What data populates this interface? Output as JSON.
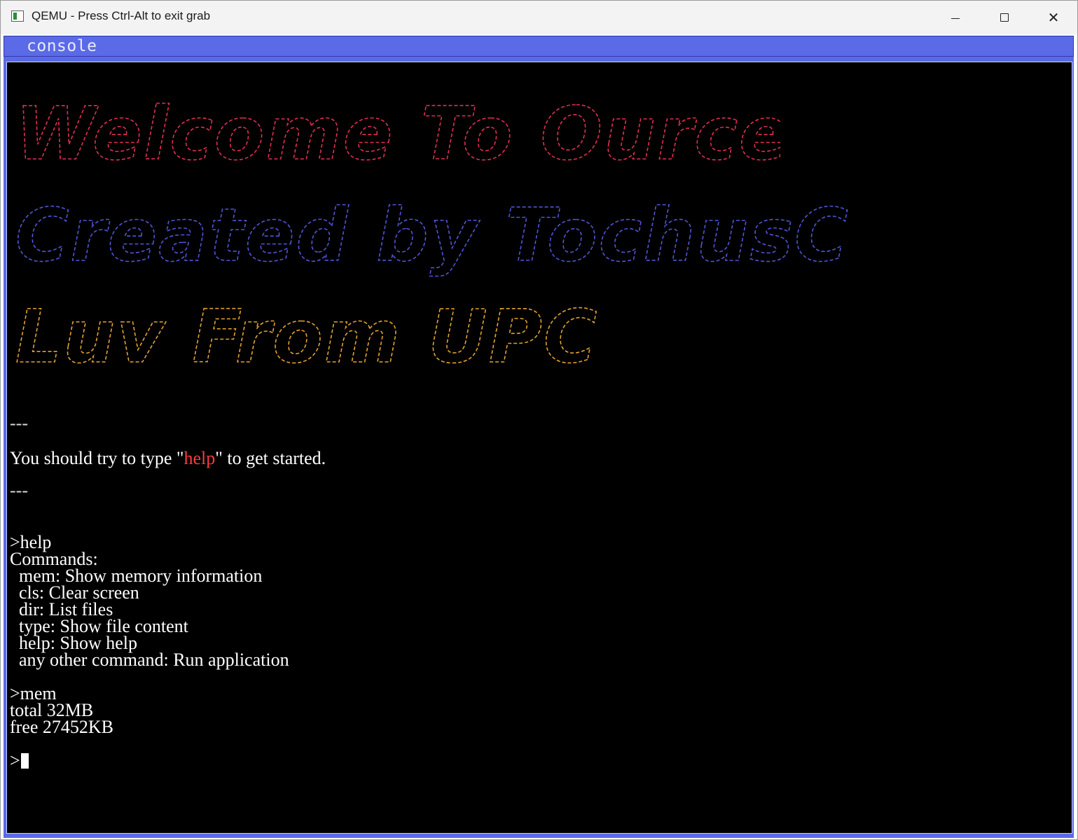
{
  "window": {
    "title": "QEMU - Press Ctrl-Alt to exit grab",
    "controls": {
      "minimize_icon": "minimize-icon",
      "maximize_icon": "maximize-icon",
      "close_icon": "close-icon",
      "close_glyph": "✕"
    }
  },
  "tabs": {
    "active_label": "console"
  },
  "colors": {
    "tab_bar": "#5b6ae6",
    "banner_line1": "#e0304e",
    "banner_line2": "#4f56d6",
    "banner_line3": "#e0a12e",
    "highlight": "#ff3b3b",
    "screen_bg": "#000000"
  },
  "banner": {
    "line1": "Welcome To Ource",
    "line2": "Created by TochusC",
    "line3": "Luv From UPC"
  },
  "terminal": {
    "separator": "---",
    "hint_prefix": "You should try to type \"",
    "hint_keyword": "help",
    "hint_suffix": "\" to get started.",
    "cmd_help": ">help",
    "commands_header": "Commands:",
    "commands": [
      "  mem: Show memory information",
      "  cls: Clear screen",
      "  dir: List files",
      "  type: Show file content",
      "  help: Show help",
      "  any other command: Run application"
    ],
    "cmd_mem": ">mem",
    "mem_total": "total 32MB",
    "mem_free": "free 27452KB",
    "prompt": ">"
  }
}
